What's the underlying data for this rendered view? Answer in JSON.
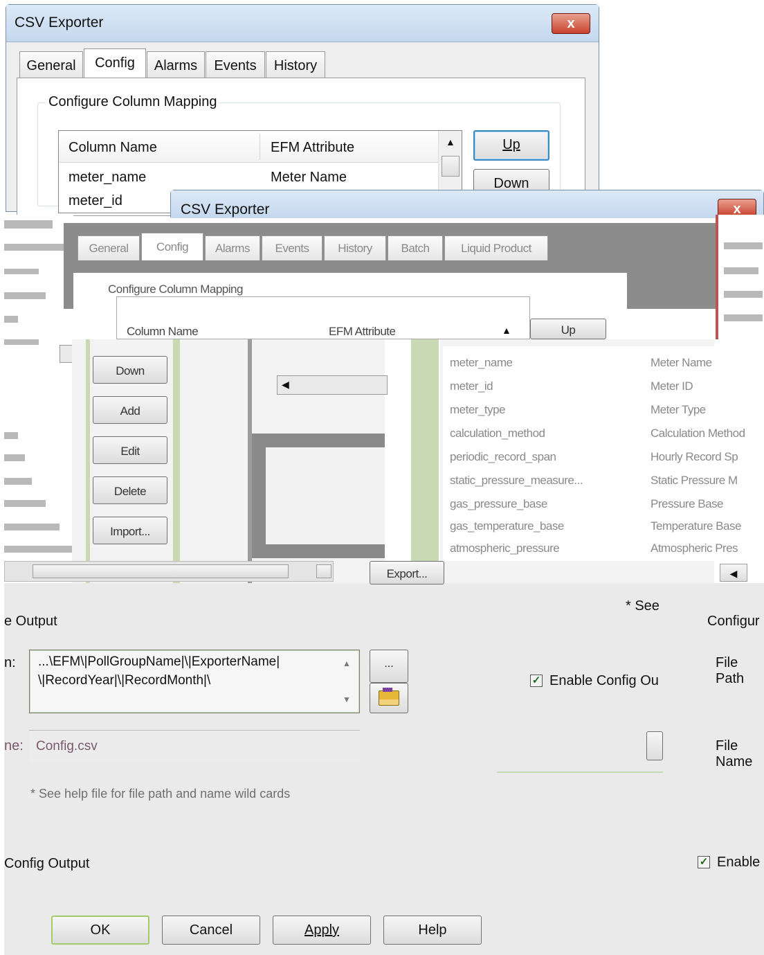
{
  "back_window": {
    "title": "CSV Exporter",
    "close_label": "x",
    "tabs": [
      "General",
      "Config",
      "Alarms",
      "Events",
      "History"
    ],
    "group_label": "Configure Column Mapping",
    "columns": [
      "Column Name",
      "EFM Attribute"
    ],
    "rows": [
      {
        "name": "meter_name",
        "attr": "Meter Name"
      },
      {
        "name": "meter_id",
        "attr": ""
      }
    ],
    "up_label": "Up",
    "down_label": "Down"
  },
  "front_window": {
    "title": "CSV Exporter",
    "close_label": "x",
    "tabs": [
      "General",
      "Config",
      "Alarms",
      "Events",
      "History",
      "Batch",
      "Liquid Product"
    ],
    "group_label": "Configure Column Mapping",
    "columns": [
      "Column Name",
      "EFM Attribute"
    ],
    "up_label": "Up",
    "side_buttons": [
      "Down",
      "Add",
      "Edit",
      "Delete",
      "Import...",
      "Export..."
    ],
    "ghost_rows": [
      {
        "name": "meter_name",
        "attr": "Meter Name"
      },
      {
        "name": "meter_id",
        "attr": "Meter ID"
      },
      {
        "name": "meter_type",
        "attr": "Meter Type"
      },
      {
        "name": "calculation_method",
        "attr": "Calculation Method"
      },
      {
        "name": "periodic_record_span",
        "attr": "Hourly Record Sp"
      },
      {
        "name": "static_pressure_measure...",
        "attr": "Static Pressure M"
      },
      {
        "name": "gas_pressure_base",
        "attr": "Pressure Base"
      },
      {
        "name": "gas_temperature_base",
        "attr": "Temperature Base"
      },
      {
        "name": "atmospheric_pressure",
        "attr": "Atmospheric Pres"
      }
    ],
    "config_output_label": "Configure Output",
    "file_path_label": "File Path",
    "file_name_label": "File Name",
    "see_label": "* See",
    "enable_config_output": "Enable Config Ou",
    "enable_label": "Enable",
    "configure_label": "Configur"
  },
  "main_window": {
    "output_group_label": "e Output",
    "path_label": "n:",
    "path_value_line1": "...\\EFM\\|PollGroupName|\\|ExporterName|",
    "path_value_line2": "\\|RecordYear|\\|RecordMonth|\\",
    "browse_label": "...",
    "name_label": "ne:",
    "name_value": "Config.csv",
    "help_note": "* See help file for file path and name wild cards",
    "enable_label": "Config Output",
    "enable_checked": true,
    "buttons": {
      "ok": "OK",
      "cancel": "Cancel",
      "apply": "Apply",
      "help": "Help"
    }
  }
}
